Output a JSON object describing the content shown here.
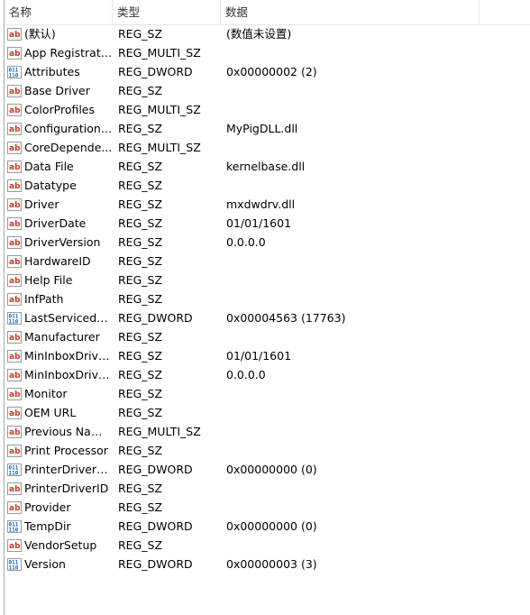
{
  "columns": {
    "name": "名称",
    "type": "类型",
    "data": "数据"
  },
  "rows": [
    {
      "name": "(默认)",
      "type": "REG_SZ",
      "data": "(数值未设置)",
      "icon": "string-value-icon"
    },
    {
      "name": "App Registrati...",
      "type": "REG_MULTI_SZ",
      "data": "",
      "icon": "string-value-icon"
    },
    {
      "name": "Attributes",
      "type": "REG_DWORD",
      "data": "0x00000002 (2)",
      "icon": "binary-value-icon"
    },
    {
      "name": "Base Driver",
      "type": "REG_SZ",
      "data": "",
      "icon": "string-value-icon"
    },
    {
      "name": "ColorProfiles",
      "type": "REG_MULTI_SZ",
      "data": "",
      "icon": "string-value-icon"
    },
    {
      "name": "Configuration ...",
      "type": "REG_SZ",
      "data": "MyPigDLL.dll",
      "icon": "string-value-icon"
    },
    {
      "name": "CoreDepende...",
      "type": "REG_MULTI_SZ",
      "data": "",
      "icon": "string-value-icon"
    },
    {
      "name": "Data File",
      "type": "REG_SZ",
      "data": "kernelbase.dll",
      "icon": "string-value-icon"
    },
    {
      "name": "Datatype",
      "type": "REG_SZ",
      "data": "",
      "icon": "string-value-icon"
    },
    {
      "name": "Driver",
      "type": "REG_SZ",
      "data": "mxdwdrv.dll",
      "icon": "string-value-icon"
    },
    {
      "name": "DriverDate",
      "type": "REG_SZ",
      "data": "01/01/1601",
      "icon": "string-value-icon"
    },
    {
      "name": "DriverVersion",
      "type": "REG_SZ",
      "data": "0.0.0.0",
      "icon": "string-value-icon"
    },
    {
      "name": "HardwareID",
      "type": "REG_SZ",
      "data": "",
      "icon": "string-value-icon"
    },
    {
      "name": "Help File",
      "type": "REG_SZ",
      "data": "",
      "icon": "string-value-icon"
    },
    {
      "name": "InfPath",
      "type": "REG_SZ",
      "data": "",
      "icon": "string-value-icon"
    },
    {
      "name": "LastServicedBu...",
      "type": "REG_DWORD",
      "data": "0x00004563 (17763)",
      "icon": "binary-value-icon"
    },
    {
      "name": "Manufacturer",
      "type": "REG_SZ",
      "data": "",
      "icon": "string-value-icon"
    },
    {
      "name": "MinInboxDrive...",
      "type": "REG_SZ",
      "data": "01/01/1601",
      "icon": "string-value-icon"
    },
    {
      "name": "MinInboxDrive...",
      "type": "REG_SZ",
      "data": "0.0.0.0",
      "icon": "string-value-icon"
    },
    {
      "name": "Monitor",
      "type": "REG_SZ",
      "data": "",
      "icon": "string-value-icon"
    },
    {
      "name": "OEM URL",
      "type": "REG_SZ",
      "data": "",
      "icon": "string-value-icon"
    },
    {
      "name": "Previous Names",
      "type": "REG_MULTI_SZ",
      "data": "",
      "icon": "string-value-icon"
    },
    {
      "name": "Print Processor",
      "type": "REG_SZ",
      "data": "",
      "icon": "string-value-icon"
    },
    {
      "name": "PrinterDriverAt...",
      "type": "REG_DWORD",
      "data": "0x00000000 (0)",
      "icon": "binary-value-icon"
    },
    {
      "name": "PrinterDriverID",
      "type": "REG_SZ",
      "data": "",
      "icon": "string-value-icon"
    },
    {
      "name": "Provider",
      "type": "REG_SZ",
      "data": "",
      "icon": "string-value-icon"
    },
    {
      "name": "TempDir",
      "type": "REG_DWORD",
      "data": "0x00000000 (0)",
      "icon": "binary-value-icon"
    },
    {
      "name": "VendorSetup",
      "type": "REG_SZ",
      "data": "",
      "icon": "string-value-icon"
    },
    {
      "name": "Version",
      "type": "REG_DWORD",
      "data": "0x00000003 (3)",
      "icon": "binary-value-icon"
    }
  ],
  "colors": {
    "string_icon": "#c0392b",
    "binary_icon": "#1a5fb4"
  }
}
